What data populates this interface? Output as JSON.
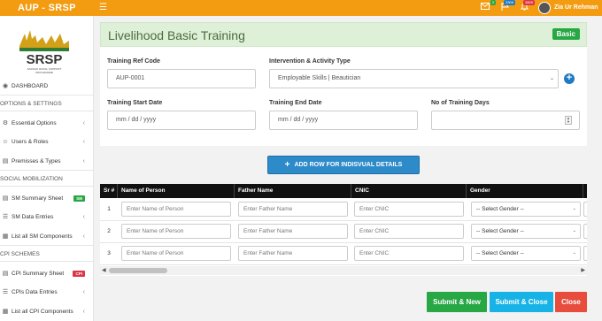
{
  "app": {
    "title": "AUP - SRSP"
  },
  "topbar": {
    "menu_icon": "hamburger-icon",
    "notifications": [
      {
        "icon": "envelope-icon",
        "badge": "3",
        "badge_color": "#28a745"
      },
      {
        "icon": "flag-icon",
        "badge": "3306",
        "badge_color": "#1f7bc1"
      },
      {
        "icon": "bell-icon",
        "badge": "3809",
        "badge_color": "#dc3545"
      }
    ],
    "user": {
      "name": "Zia Ur Rehman"
    }
  },
  "sidebar": {
    "logo": {
      "name": "SRSP",
      "tagline": "SARHAD RURAL SUPPORT PROGRAMME"
    },
    "items": [
      {
        "label": "DASHBOARD",
        "icon": "dashboard-icon"
      },
      {
        "label": "OPTIONS & SETTINGS"
      },
      {
        "label": "Essential Options",
        "icon": "gear-icon"
      },
      {
        "label": "Users & Roles",
        "icon": "user-icon"
      },
      {
        "label": "Premisses & Types",
        "icon": "building-icon"
      },
      {
        "label": "SOCIAL MOBILIZATION"
      },
      {
        "label": "SM Summary Sheet",
        "icon": "sheet-icon",
        "pill": "SM",
        "pill_color": "#28a745"
      },
      {
        "label": "SM Data Entries",
        "icon": "list-icon"
      },
      {
        "label": "List all SM Components",
        "icon": "grid-icon"
      },
      {
        "label": "CPI SCHEMES"
      },
      {
        "label": "CPI Summary Sheet",
        "icon": "sheet-icon",
        "pill": "CPI",
        "pill_color": "#dc3545"
      },
      {
        "label": "CPIs Data Entries",
        "icon": "list-icon"
      },
      {
        "label": "List all CPI Components",
        "icon": "grid-icon"
      }
    ]
  },
  "page": {
    "title": "Livelihood Basic Training",
    "badge": "Basic",
    "badge_color": "#28a745"
  },
  "form": {
    "ref_code": {
      "label": "Training Ref Code",
      "value": "AUP-0001"
    },
    "intervention": {
      "label": "Intervention & Activity Type",
      "value": "Employable Skills | Beautician"
    },
    "start_date": {
      "label": "Training Start Date",
      "placeholder": "mm / dd / yyyy"
    },
    "end_date": {
      "label": "Training End Date",
      "placeholder": "mm / dd / yyyy"
    },
    "days": {
      "label": "No of Training Days",
      "value": ""
    }
  },
  "add_row_button": {
    "label": "ADD ROW FOR INDISVUAL DETAILS"
  },
  "table": {
    "headers": [
      "Sr #",
      "Name of Person",
      "Father Name",
      "CNIC",
      "Gender"
    ],
    "rows": [
      {
        "sr": "1",
        "name_ph": "Enter Name of Person",
        "father_ph": "Enter Father Name",
        "cnic_ph": "Enter CNIC",
        "gender": "-- Select Gender --"
      },
      {
        "sr": "2",
        "name_ph": "Enter Name of Person",
        "father_ph": "Enter Father Name",
        "cnic_ph": "Enter CNIC",
        "gender": "-- Select Gender --"
      },
      {
        "sr": "3",
        "name_ph": "Enter Name of Person",
        "father_ph": "Enter Father Name",
        "cnic_ph": "Enter CNIC",
        "gender": "-- Select Gender --"
      }
    ]
  },
  "footer_buttons": {
    "submit_new": {
      "label": "Submit & New",
      "color": "#28a745"
    },
    "submit_close": {
      "label": "Submit & Close",
      "color": "#17b3e6"
    },
    "close": {
      "label": "Close",
      "color": "#e74c3c"
    }
  }
}
